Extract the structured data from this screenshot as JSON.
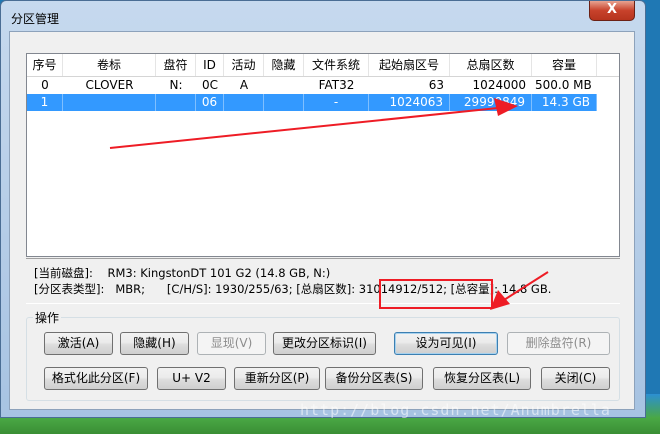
{
  "window": {
    "title": "分区管理",
    "close_label": "X"
  },
  "listview": {
    "columns": [
      "序号",
      "卷标",
      "盘符",
      "ID",
      "活动",
      "隐藏",
      "文件系统",
      "起始扇区号",
      "总扇区数",
      "容量"
    ],
    "rows": [
      {
        "index": "0",
        "label": "CLOVER",
        "drive": "N:",
        "id": "0C",
        "active": "A",
        "hidden": "",
        "fs": "FAT32",
        "start": "63",
        "total": "1024000",
        "size": "500.0 MB",
        "selected": false
      },
      {
        "index": "1",
        "label": "",
        "drive": "",
        "id": "06",
        "active": "",
        "hidden": "",
        "fs": "-",
        "start": "1024063",
        "total": "29990849",
        "size": "14.3 GB",
        "selected": true
      }
    ]
  },
  "info": {
    "line1_label": "[当前磁盘]:",
    "line1_value": "RM3: KingstonDT 101 G2 (14.8 GB, N:)",
    "line2": "[分区表类型]:   MBR;      [C/H/S]: 1930/255/63; [总扇区数]: 31014912/512; [总容量]: 14.8 GB."
  },
  "operations": {
    "group_label": "操作",
    "buttons_row1": [
      {
        "label": "激活(A)",
        "disabled": false
      },
      {
        "label": "隐藏(H)",
        "disabled": false
      },
      {
        "label": "显现(V)",
        "disabled": true
      },
      {
        "label": "更改分区标识(I)",
        "disabled": false
      },
      {
        "label": "设为可见(I)",
        "disabled": false
      },
      {
        "label": "删除盘符(R)",
        "disabled": true
      }
    ],
    "buttons_row2": [
      {
        "label": "格式化此分区(F)",
        "disabled": false
      },
      {
        "label": "U+ V2",
        "disabled": false
      },
      {
        "label": "重新分区(P)",
        "disabled": false
      },
      {
        "label": "备份分区表(S)",
        "disabled": false
      },
      {
        "label": "恢复分区表(L)",
        "disabled": false
      },
      {
        "label": "关闭(C)",
        "disabled": false
      }
    ]
  },
  "annotations": {
    "color": "#ee1c25"
  },
  "watermark": "http://blog.csdn.net/Anumbrella"
}
